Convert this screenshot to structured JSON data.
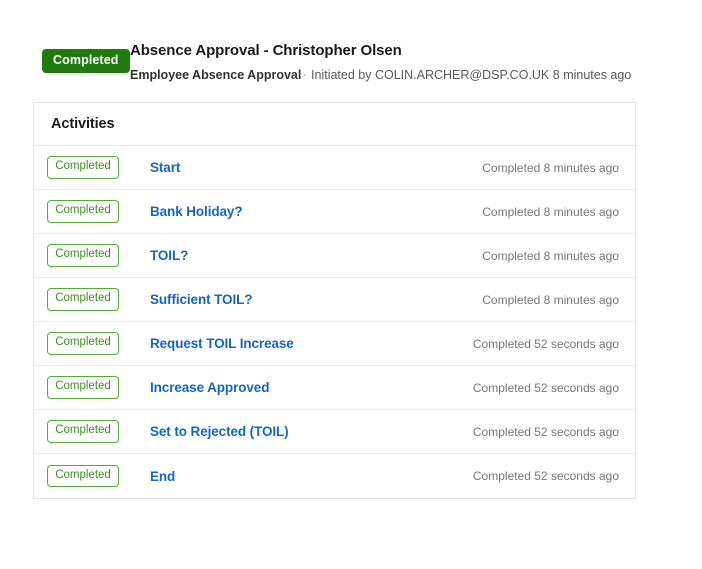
{
  "header": {
    "status_label": "Completed",
    "status_color": "#217a0d",
    "title": "Absence Approval - Christopher Olsen",
    "process_name": "Employee Absence Approval",
    "separator": "·",
    "initiated_by_prefix": "Initiated by",
    "initiated_by_user": "COLIN.ARCHER@DSP.CO.UK",
    "initiated_time": "8 minutes ago",
    "subtitle_full": "Employee Absence Approval · Initiated by COLIN.ARCHER@DSP.CO.UK 8 minutes ago"
  },
  "activities_panel": {
    "title": "Activities",
    "link_color": "#1566c0",
    "badge_border_color": "#5aa83c",
    "badge_text_color": "#3f8f23",
    "rows": [
      {
        "status": "Completed",
        "name": "Start",
        "time": "Completed 8 minutes ago"
      },
      {
        "status": "Completed",
        "name": "Bank Holiday?",
        "time": "Completed 8 minutes ago"
      },
      {
        "status": "Completed",
        "name": "TOIL?",
        "time": "Completed 8 minutes ago"
      },
      {
        "status": "Completed",
        "name": "Sufficient TOIL?",
        "time": "Completed 8 minutes ago"
      },
      {
        "status": "Completed",
        "name": "Request TOIL Increase",
        "time": "Completed 52 seconds ago"
      },
      {
        "status": "Completed",
        "name": "Increase Approved",
        "time": "Completed 52 seconds ago"
      },
      {
        "status": "Completed",
        "name": "Set to Rejected (TOIL)",
        "time": "Completed 52 seconds ago"
      },
      {
        "status": "Completed",
        "name": "End",
        "time": "Completed 52 seconds ago"
      }
    ]
  }
}
